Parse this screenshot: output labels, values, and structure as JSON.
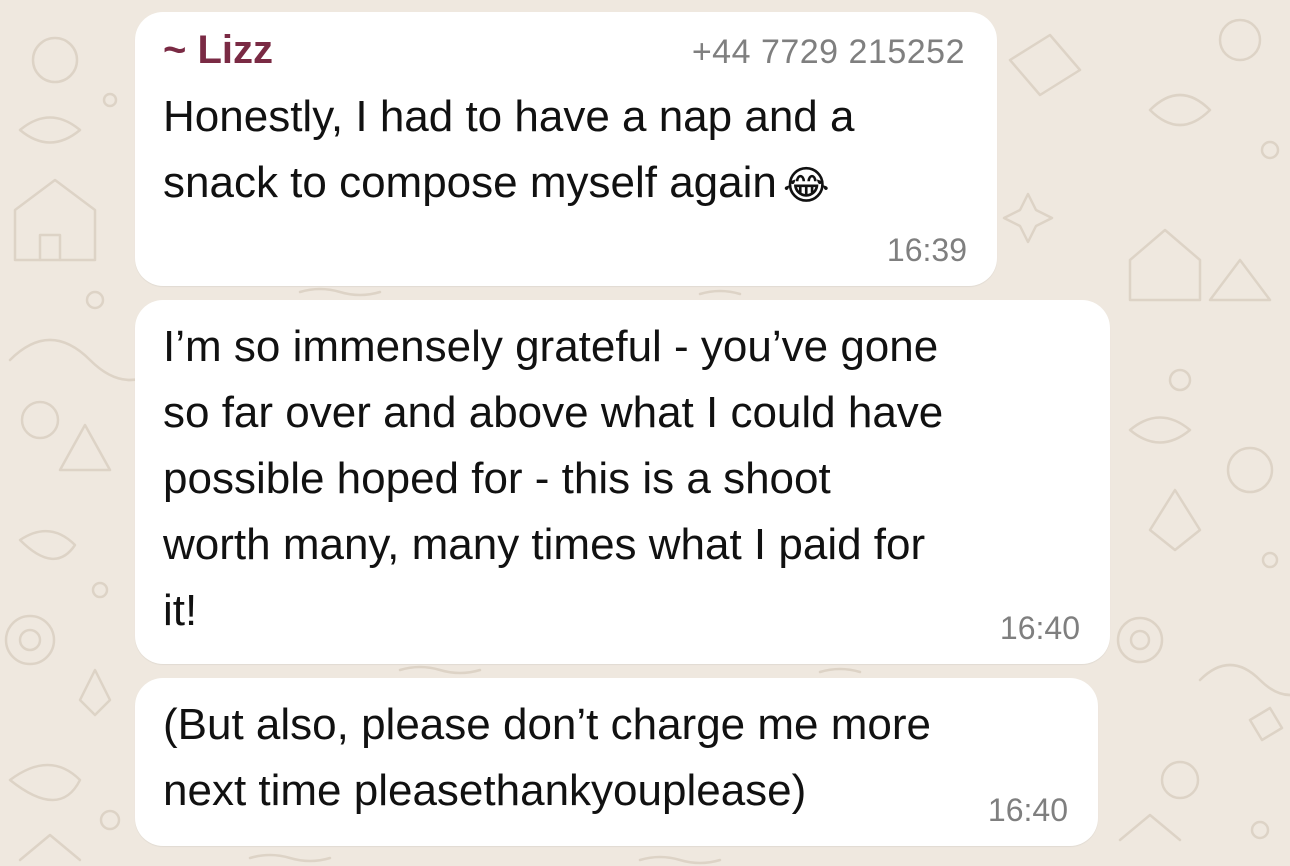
{
  "theme": {
    "background": "#efe8df",
    "bubble": "#ffffff",
    "sender_color": "#7a2a44",
    "meta_color": "#7f7f7f"
  },
  "messages": [
    {
      "sender": "~ Lizz",
      "phone": "+44 7729 215252",
      "text": "Honestly, I had to have a nap and a\nsnack to compose myself again",
      "emoji": "😂",
      "emoji_name": "face-with-tears-of-joy-icon",
      "time": "16:39"
    },
    {
      "text": "I’m so immensely grateful - you’ve gone\nso far over and above what I could have\npossible hoped for - this is a shoot\nworth many, many times what I paid for\nit!",
      "time": "16:40"
    },
    {
      "text": "(But also, please don’t charge me more\nnext time pleasethankyouplease)",
      "time": "16:40"
    }
  ]
}
